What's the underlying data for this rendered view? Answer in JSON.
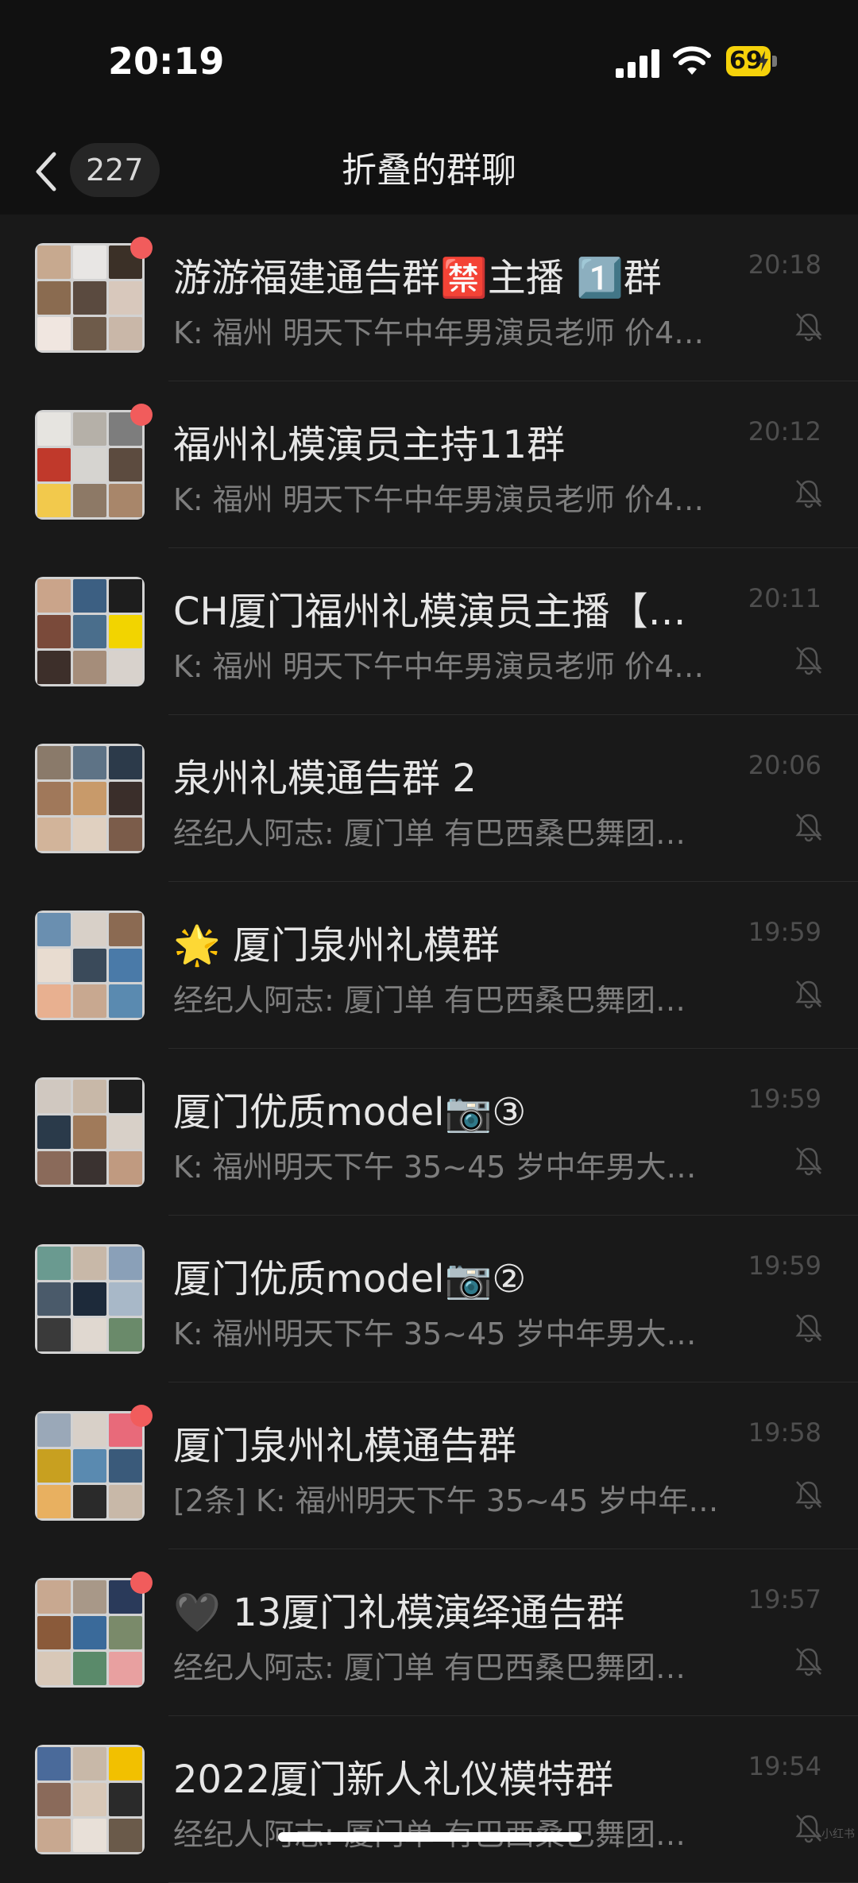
{
  "status_bar": {
    "time": "20:19",
    "battery": "69",
    "signal": "signal-bars-icon",
    "wifi": "wifi-icon"
  },
  "header": {
    "back_count": "227",
    "title": "折叠的群聊",
    "back_icon": "chevron-left-icon"
  },
  "chats": [
    {
      "name": "游游福建通告群🈲主播 1️⃣群",
      "time": "20:18",
      "preview": "K: 福州 明天下午中年男演员老师 价4…",
      "unread": true,
      "muted": true,
      "tiles": [
        "#c7a98f",
        "#e8e6e4",
        "#3b3027",
        "#8a6b50",
        "#5a4a3f",
        "#d8c8bc",
        "#f0e6e0",
        "#6e5b4a",
        "#c9b7a8"
      ]
    },
    {
      "name": "福州礼模演员主持11群",
      "time": "20:12",
      "preview": "K: 福州 明天下午中年男演员老师 价4…",
      "unread": true,
      "muted": true,
      "tiles": [
        "#e6e4e0",
        "#b5b0a8",
        "#7d7d7d",
        "#c0392b",
        "#d6d4d0",
        "#5c4b3f",
        "#f2c94c",
        "#8d7966",
        "#a8866a"
      ]
    },
    {
      "name": "CH厦门福州礼模演员主播【…",
      "time": "20:11",
      "preview": "K: 福州 明天下午中年男演员老师 价4…",
      "unread": false,
      "muted": true,
      "tiles": [
        "#caa48a",
        "#3c5f82",
        "#1d1d1d",
        "#7a4a3a",
        "#4a6e8c",
        "#f2d400",
        "#3d2f2a",
        "#a58d7a",
        "#d8d2cc"
      ]
    },
    {
      "name": "泉州礼模通告群 2",
      "time": "20:06",
      "preview": "经纪人阿志: 厦门单 有巴西桑巴舞团…",
      "unread": false,
      "muted": true,
      "tiles": [
        "#8a7a6a",
        "#5e7386",
        "#2c3a4a",
        "#a0785a",
        "#c89a6a",
        "#3a2e2a",
        "#d2b49a",
        "#e0d0c0",
        "#7b5c4a"
      ]
    },
    {
      "name": "🌟 厦门泉州礼模群",
      "time": "19:59",
      "preview": "经纪人阿志: 厦门单 有巴西桑巴舞团…",
      "unread": false,
      "muted": true,
      "tiles": [
        "#6a8fb0",
        "#d8d0c8",
        "#8b6a52",
        "#e8dcd0",
        "#3a4a5a",
        "#4a7aa8",
        "#e8b090",
        "#c8a890",
        "#5a8ab0"
      ]
    },
    {
      "name": "厦门优质model📷③",
      "time": "19:59",
      "preview": "K:  福州明天下午 35~45 岁中年男大…",
      "unread": false,
      "muted": true,
      "tiles": [
        "#d0c8c0",
        "#c8b8a8",
        "#1d1d1d",
        "#2a3a4a",
        "#a07a5a",
        "#d8d0c8",
        "#8a6a5a",
        "#3a3230",
        "#c09a80"
      ]
    },
    {
      "name": "厦门优质model📷②",
      "time": "19:59",
      "preview": "K:  福州明天下午 35~45 岁中年男大…",
      "unread": false,
      "muted": true,
      "tiles": [
        "#6a9a90",
        "#c8b8a8",
        "#8aa0b8",
        "#4a5a6a",
        "#1d2a3a",
        "#a8b8c8",
        "#3a3a3a",
        "#e0d8d0",
        "#6a8a6a"
      ]
    },
    {
      "name": "厦门泉州礼模通告群",
      "time": "19:58",
      "preview": "[2条] K: 福州明天下午 35~45 岁中年…",
      "unread": true,
      "muted": true,
      "tiles": [
        "#9aa8b8",
        "#d8d0c8",
        "#e86a7a",
        "#c8a020",
        "#5a8ab0",
        "#3a5a7a",
        "#e8b060",
        "#2a2a2a",
        "#c8b8a8"
      ]
    },
    {
      "name": "🖤 13厦门礼模演绎通告群",
      "time": "19:57",
      "preview": "经纪人阿志: 厦门单 有巴西桑巴舞团…",
      "unread": true,
      "muted": true,
      "tiles": [
        "#c8a890",
        "#a89888",
        "#2a3a5a",
        "#8a5a3a",
        "#3a6a9a",
        "#7a8a6a",
        "#d8c8b8",
        "#5a8a6a",
        "#e8a0a0"
      ]
    },
    {
      "name": "2022厦门新人礼仪模特群",
      "time": "19:54",
      "preview": "经纪人阿志: 厦门单 有巴西桑巴舞团…",
      "unread": false,
      "muted": true,
      "tiles": [
        "#4a6a9a",
        "#c8b8a8",
        "#f2c000",
        "#8a6a5a",
        "#d8c8b8",
        "#2a2a2a",
        "#c8a890",
        "#e8e0d8",
        "#6a5a4a"
      ]
    }
  ],
  "watermark": "小红书"
}
